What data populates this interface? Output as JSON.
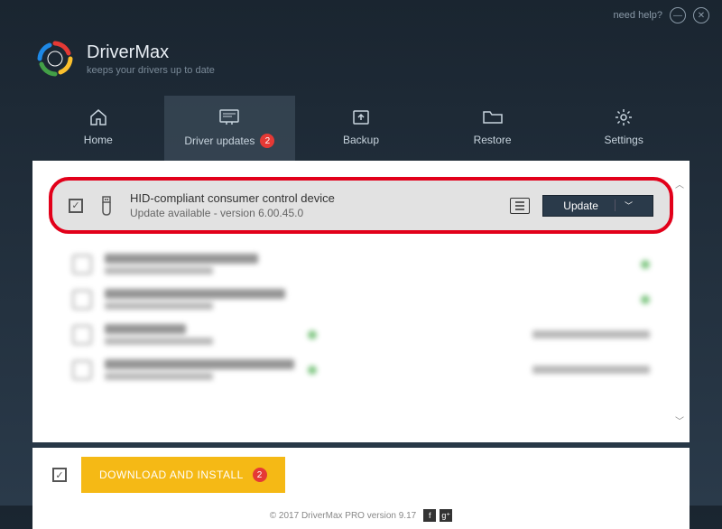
{
  "topbar": {
    "help": "need help?"
  },
  "brand": {
    "title": "DriverMax",
    "subtitle": "keeps your drivers up to date"
  },
  "nav": {
    "home": "Home",
    "updates": "Driver updates",
    "updates_badge": "2",
    "backup": "Backup",
    "restore": "Restore",
    "settings": "Settings"
  },
  "highlight": {
    "name": "HID-compliant consumer control device",
    "sub": "Update available - version 6.00.45.0",
    "update_btn": "Update"
  },
  "bottom": {
    "download": "DOWNLOAD AND INSTALL",
    "badge": "2"
  },
  "footer": {
    "text": "© 2017 DriverMax PRO version 9.17"
  }
}
